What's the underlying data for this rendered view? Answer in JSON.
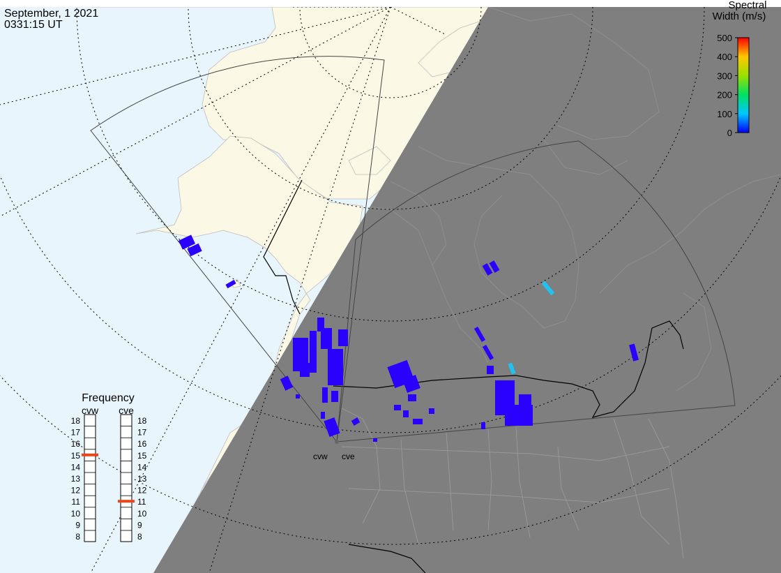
{
  "header": {
    "date": "September, 1 2021",
    "time": "0331:15 UT"
  },
  "colorbar": {
    "title_line1": "Spectral",
    "title_line2": "Width (m/s)",
    "ticks": [
      "500",
      "400",
      "300",
      "200",
      "100",
      "0"
    ]
  },
  "frequency": {
    "title": "Frequency",
    "scale": [
      "18",
      "17",
      "16",
      "15",
      "14",
      "13",
      "12",
      "11",
      "10",
      "9",
      "8"
    ],
    "radars": [
      {
        "name": "cvw",
        "value": 15
      },
      {
        "name": "cve",
        "value": 11
      }
    ]
  },
  "stations": [
    {
      "label": "cvw"
    },
    {
      "label": "cve"
    }
  ],
  "colors": {
    "ocean": "#e8f5fd",
    "land": "#fbf9e5",
    "night": "#7f7f7f",
    "scatter_low": "#2a00ff",
    "scatter_mid": "#1fc2f0",
    "freq_marker": "#e8461c"
  }
}
